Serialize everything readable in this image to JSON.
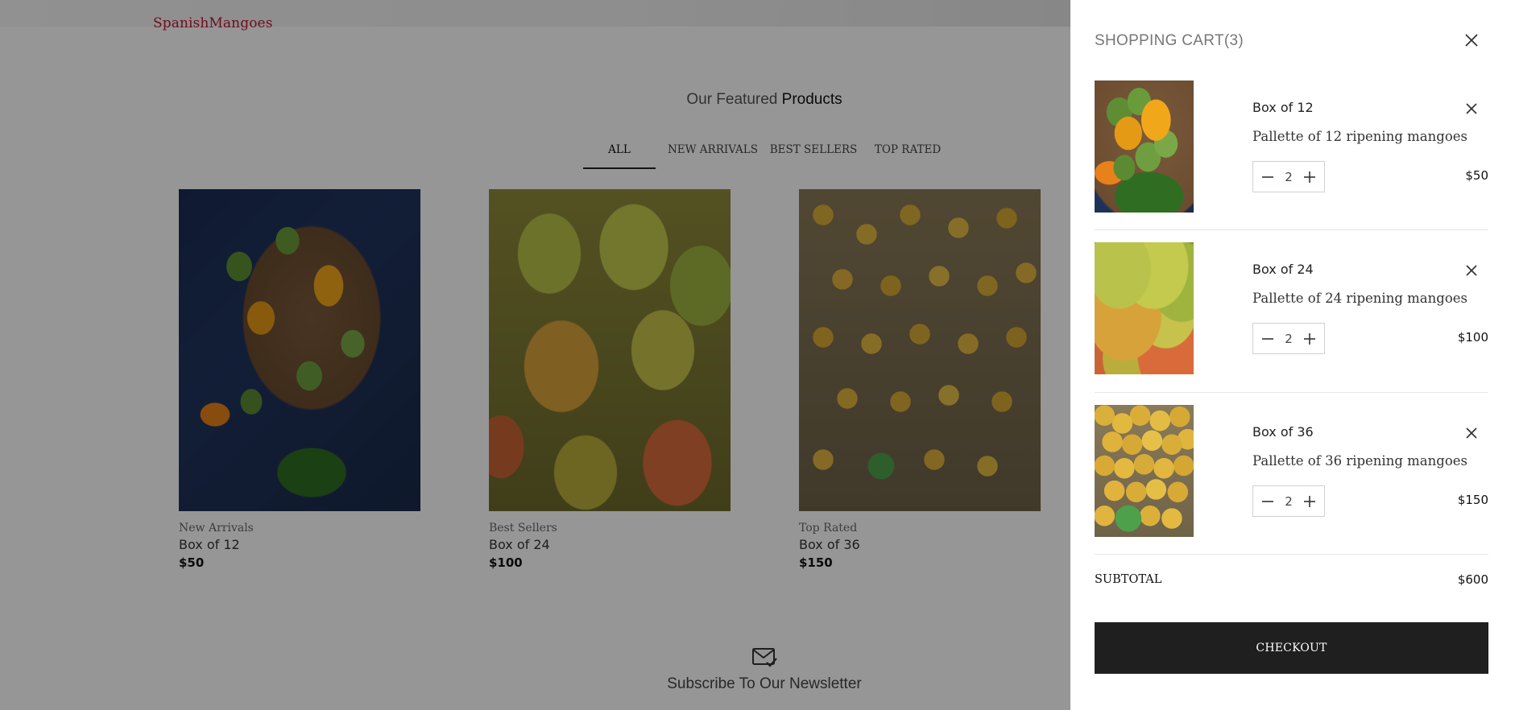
{
  "header": {
    "logo": "SpanishMangoes"
  },
  "featured": {
    "title_light": "Our Featured",
    "title_strong": "Products"
  },
  "tabs": [
    {
      "label": "ALL",
      "active": true
    },
    {
      "label": "NEW ARRIVALS",
      "active": false
    },
    {
      "label": "BEST SELLERS",
      "active": false
    },
    {
      "label": "TOP RATED",
      "active": false
    }
  ],
  "products": [
    {
      "category": "New Arrivals",
      "name": "Box of 12",
      "price": "$50",
      "image": "mangoes-in-crate"
    },
    {
      "category": "Best Sellers",
      "name": "Box of 24",
      "price": "$100",
      "image": "large-mango-pile"
    },
    {
      "category": "Top Rated",
      "name": "Box of 36",
      "price": "$150",
      "image": "small-mango-pile"
    }
  ],
  "newsletter": {
    "label": "Subscribe To Our Newsletter",
    "icon": "mail-check-icon"
  },
  "cart": {
    "title": "SHOPPING CART(3)",
    "items": [
      {
        "name": "Box of 12",
        "description": "Pallette of 12 ripening mangoes",
        "quantity": "2",
        "price": "$50"
      },
      {
        "name": "Box of 24",
        "description": "Pallette of 24 ripening mangoes",
        "quantity": "2",
        "price": "$100"
      },
      {
        "name": "Box of 36",
        "description": "Pallette of 36 ripening mangoes",
        "quantity": "2",
        "price": "$150"
      }
    ],
    "subtotal_label": "SUBTOTAL",
    "subtotal_value": "$600",
    "checkout_label": "CHECKOUT"
  },
  "colors": {
    "brand": "#c01631",
    "overlay": "rgba(0,0,0,0.41)",
    "checkout_bg": "#1f1f1f"
  }
}
